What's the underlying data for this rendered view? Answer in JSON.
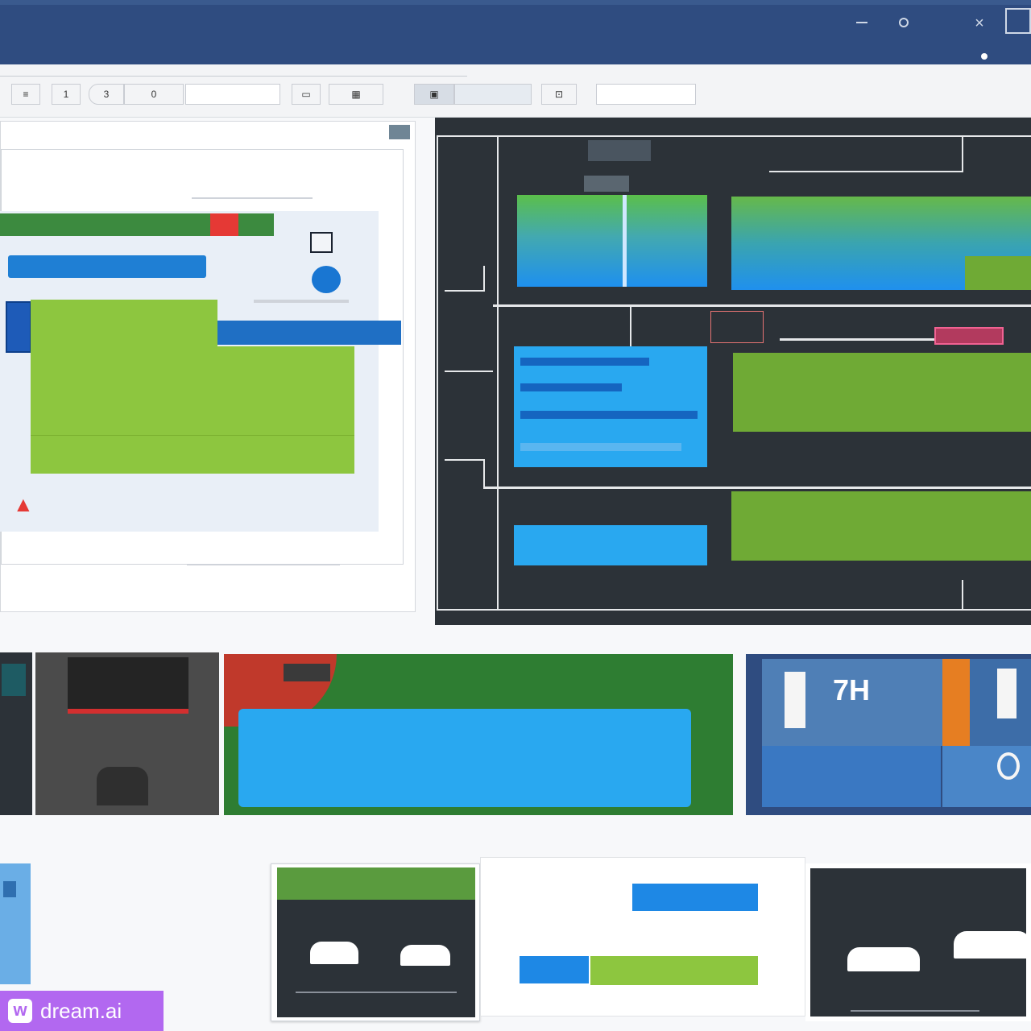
{
  "titlebar": {
    "controls": [
      "minimize",
      "restore",
      "close"
    ]
  },
  "toolbar": {
    "buttons": [
      "1",
      "3",
      "0"
    ],
    "select_value": "",
    "right_text": ""
  },
  "left_panel": {
    "header": "",
    "green_bar_label": "",
    "blue_button_label": "",
    "card_title": "",
    "card_line1": "",
    "card_line2": "",
    "card_line3": "",
    "footnote": "",
    "side_blue_label": ""
  },
  "diagram": {
    "top_label": "",
    "block_a": "",
    "block_b": "",
    "big_green_label": "",
    "bottom_green_label": "",
    "bottom_blue_label": ""
  },
  "thumbnails": {
    "banner_text": "",
    "tile_number": "7H"
  },
  "bottom": {
    "left_text": "",
    "cards": [
      "",
      "",
      ""
    ]
  },
  "watermark": {
    "text": "dream.ai",
    "logo_letter": "w"
  },
  "colors": {
    "navy": "#2f4c80",
    "dark": "#2c3238",
    "green": "#6faa35",
    "lime": "#8dc63f",
    "blue": "#1e88e5",
    "cyan": "#29a8f0",
    "red": "#d32f2f",
    "watermark": "#b268f0"
  }
}
